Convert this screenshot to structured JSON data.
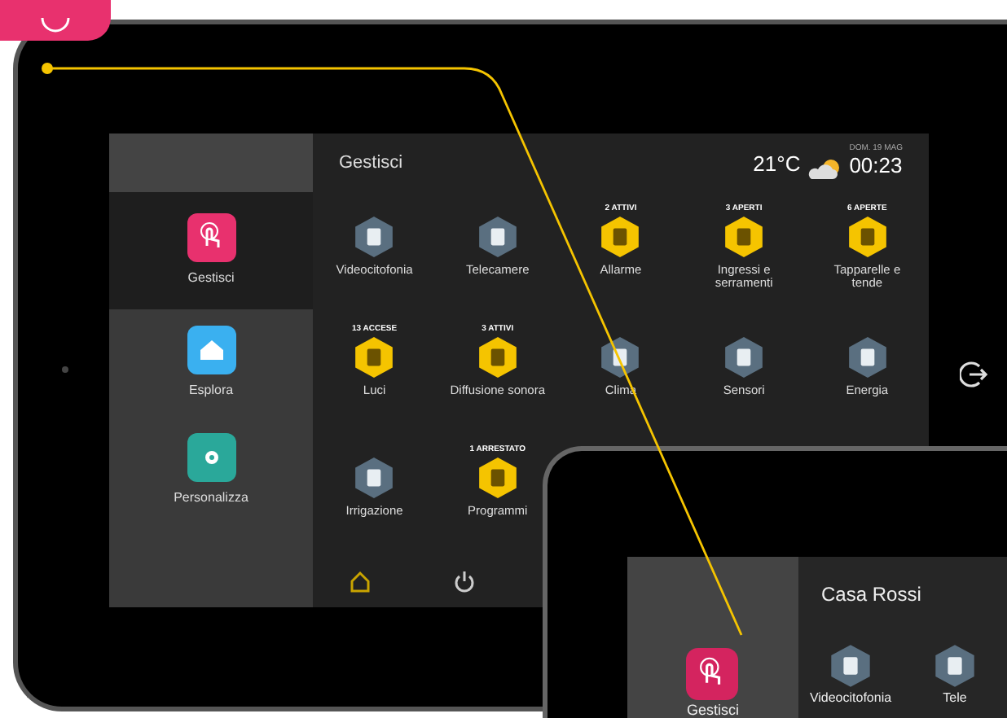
{
  "main_tablet": {
    "sidebar": [
      {
        "label": "Gestisci",
        "selected": true,
        "color": "#e8316e",
        "kind": "hand"
      },
      {
        "label": "Esplora",
        "selected": false,
        "color": "#3ab0f0",
        "kind": "home"
      },
      {
        "label": "Personalizza",
        "selected": false,
        "color": "#2aa89a",
        "kind": "gear"
      }
    ],
    "header": {
      "title": "Gestisci",
      "temperature": "21°C",
      "date": "DOM. 19 MAG",
      "time": "00:23"
    },
    "tiles": [
      {
        "label": "Videocitofonia",
        "active": false
      },
      {
        "label": "Telecamere",
        "active": false
      },
      {
        "label": "Allarme",
        "active": true,
        "badge": "2 ATTIVI"
      },
      {
        "label": "Ingressi e serramenti",
        "active": true,
        "badge": "3 APERTI"
      },
      {
        "label": "Tapparelle e tende",
        "active": true,
        "badge": "6 APERTE"
      },
      {
        "label": "Luci",
        "active": true,
        "badge": "13 ACCESE"
      },
      {
        "label": "Diffusione sonora",
        "active": true,
        "badge": "3 ATTIVI"
      },
      {
        "label": "Clima",
        "active": false
      },
      {
        "label": "Sensori",
        "active": false
      },
      {
        "label": "Energia",
        "active": false
      },
      {
        "label": "Irrigazione",
        "active": false
      },
      {
        "label": "Programmi",
        "active": true,
        "badge": "1 ARRESTATO"
      }
    ],
    "bottom_bar": [
      {
        "kind": "home",
        "selected": true
      },
      {
        "kind": "power",
        "selected": false
      }
    ]
  },
  "second_tablet": {
    "title": "Casa Rossi",
    "sidebar": [
      {
        "label": "Gestisci",
        "selected": true,
        "color": "#d4245f"
      }
    ],
    "tiles": [
      {
        "label": "Videocitofonia"
      },
      {
        "label": "Tele"
      }
    ]
  }
}
